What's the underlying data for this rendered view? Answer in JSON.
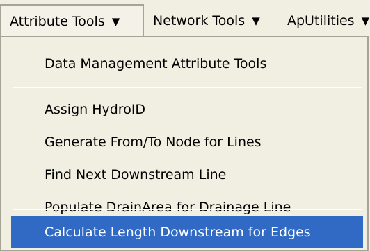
{
  "menubar": {
    "menus": [
      {
        "label": "Attribute Tools",
        "arrow": "▼"
      },
      {
        "label": "Network Tools",
        "arrow": "▼"
      },
      {
        "label": "ApUtilities",
        "arrow": "▼"
      }
    ]
  },
  "dropdown": {
    "items": [
      {
        "label": "Data Management Attribute Tools"
      },
      {
        "label": "Assign HydroID"
      },
      {
        "label": "Generate From/To Node for Lines"
      },
      {
        "label": "Find Next Downstream Line"
      },
      {
        "label": "Populate DrainArea for Drainage Line"
      },
      {
        "label": "Calculate Length Downstream for Edges",
        "highlighted": true
      }
    ]
  },
  "colors": {
    "highlight": "#316ac5",
    "menu_background": "#f1efe2"
  }
}
